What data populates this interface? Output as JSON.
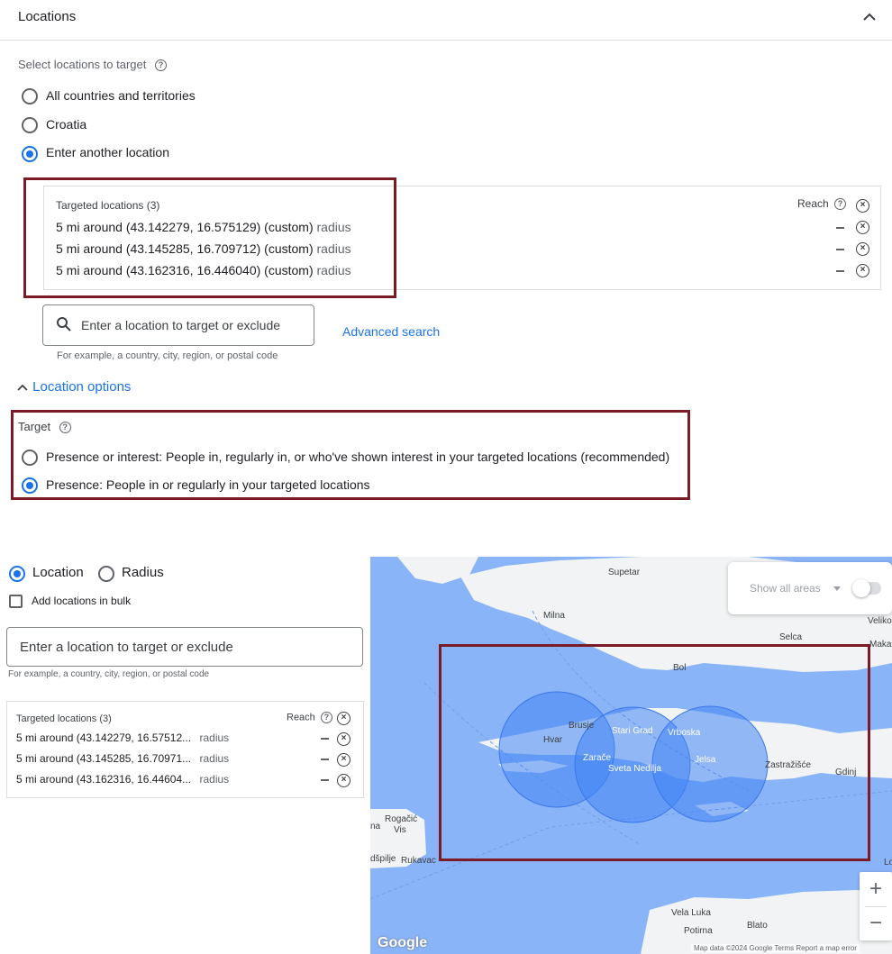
{
  "header": {
    "title": "Locations"
  },
  "top": {
    "select_label": "Select locations to target",
    "options": [
      "All countries and territories",
      "Croatia",
      "Enter another location"
    ],
    "targeted_title": "Targeted locations (3)",
    "reach_label": "Reach",
    "locations": [
      {
        "text": "5 mi around (43.142279, 16.575129) (custom)",
        "suffix": "radius"
      },
      {
        "text": "5 mi around (43.145285, 16.709712) (custom)",
        "suffix": "radius"
      },
      {
        "text": "5 mi around (43.162316, 16.446040) (custom)",
        "suffix": "radius"
      }
    ],
    "search_placeholder": "Enter a location to target or exclude",
    "search_hint": "For example, a country, city, region, or postal code",
    "advanced_search": "Advanced search",
    "location_options": "Location options",
    "target_label": "Target",
    "target_options": [
      "Presence or interest: People in, regularly in, or who've shown interest in your targeted locations (recommended)",
      "Presence: People in or regularly in your targeted locations"
    ]
  },
  "bottom": {
    "tab_location": "Location",
    "tab_radius": "Radius",
    "bulk_label": "Add locations in bulk",
    "search_placeholder": "Enter a location to target or exclude",
    "search_hint": "For example, a country, city, region, or postal code",
    "targeted_title": "Targeted locations (3)",
    "reach_label": "Reach",
    "locations": [
      {
        "text": "5 mi around (43.142279, 16.57512...",
        "suffix": "radius"
      },
      {
        "text": "5 mi around (43.145285, 16.70971...",
        "suffix": "radius"
      },
      {
        "text": "5 mi around (43.162316, 16.44604...",
        "suffix": "radius"
      }
    ]
  },
  "map": {
    "show_all_areas": "Show all areas",
    "place_labels": {
      "supetar": "Supetar",
      "milna": "Milna",
      "selca": "Selca",
      "veliko": "Veliko",
      "maka": "Maka",
      "bol": "Bol",
      "brusje": "Brusje",
      "hvar": "Hvar",
      "stari_grad": "Stari Grad",
      "vrboska": "Vrboska",
      "zarace": "Zarače",
      "sveta_nedilja": "Sveta Nedilja",
      "jelsa": "Jelsa",
      "zastrazisce": "Zastražišće",
      "gdinj": "Gdinj",
      "rogacic": "Rogačić",
      "na": "na",
      "vis": "Vis",
      "dspilje": "dšpilje",
      "rukavac": "Rukavac",
      "lo": "Lo",
      "vela_luka": "Vela Luka",
      "blato": "Blato",
      "potirna": "Potirna"
    },
    "attribution": "Map data ©2024 Google   Terms   Report a map error",
    "logo": "Google",
    "zoom_in": "+",
    "zoom_out": "−",
    "water_color": "#8ab4f8",
    "land_color": "#f1f3f4",
    "circle_color": "#4285f4"
  }
}
